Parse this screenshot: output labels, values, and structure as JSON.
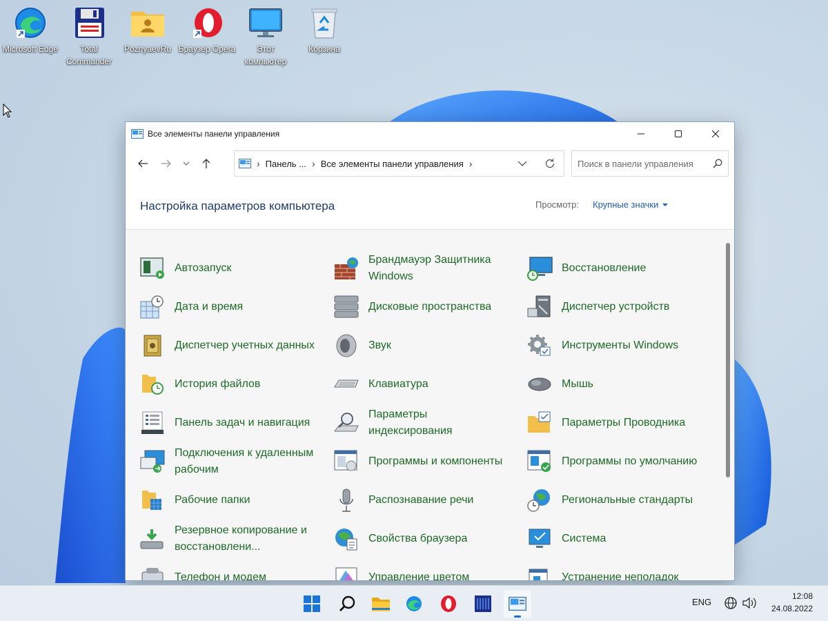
{
  "desktop": {
    "icons": [
      {
        "label": "Microsoft Edge",
        "icon": "edge-icon"
      },
      {
        "label": "Total Commander",
        "icon": "floppy-icon"
      },
      {
        "label": "PoznyaevRu",
        "icon": "user-folder-icon"
      },
      {
        "label": "Браузер Opera",
        "icon": "opera-icon"
      },
      {
        "label": "Этот компьютер",
        "icon": "monitor-icon"
      },
      {
        "label": "Корзина",
        "icon": "recycle-bin-icon"
      }
    ]
  },
  "window": {
    "title": "Все элементы панели управления",
    "breadcrumbs": [
      "Панель ...",
      "Все элементы панели управления"
    ],
    "search_placeholder": "Поиск в панели управления",
    "header_title": "Настройка параметров компьютера",
    "view_label": "Просмотр:",
    "view_value": "Крупные значки",
    "items": [
      {
        "label": "Автозапуск",
        "icon": "autoplay-icon"
      },
      {
        "label": "Брандмауэр Защитника Windows",
        "icon": "firewall-icon"
      },
      {
        "label": "Восстановление",
        "icon": "recovery-icon"
      },
      {
        "label": "Дата и время",
        "icon": "date-time-icon"
      },
      {
        "label": "Дисковые пространства",
        "icon": "storage-spaces-icon"
      },
      {
        "label": "Диспетчер устройств",
        "icon": "device-manager-icon"
      },
      {
        "label": "Диспетчер учетных данных",
        "icon": "credential-manager-icon"
      },
      {
        "label": "Звук",
        "icon": "sound-icon"
      },
      {
        "label": "Инструменты Windows",
        "icon": "windows-tools-icon"
      },
      {
        "label": "История файлов",
        "icon": "file-history-icon"
      },
      {
        "label": "Клавиатура",
        "icon": "keyboard-icon"
      },
      {
        "label": "Мышь",
        "icon": "mouse-icon"
      },
      {
        "label": "Панель задач и навигация",
        "icon": "taskbar-icon"
      },
      {
        "label": "Параметры индексирования",
        "icon": "indexing-icon"
      },
      {
        "label": "Параметры Проводника",
        "icon": "explorer-options-icon"
      },
      {
        "label": "Подключения к удаленным рабочим",
        "icon": "remote-desktop-icon"
      },
      {
        "label": "Программы и компоненты",
        "icon": "programs-icon"
      },
      {
        "label": "Программы по умолчанию",
        "icon": "default-programs-icon"
      },
      {
        "label": "Рабочие папки",
        "icon": "work-folders-icon"
      },
      {
        "label": "Распознавание речи",
        "icon": "speech-icon"
      },
      {
        "label": "Региональные стандарты",
        "icon": "region-icon"
      },
      {
        "label": "Резервное копирование и восстановлени...",
        "icon": "backup-icon"
      },
      {
        "label": "Свойства браузера",
        "icon": "internet-options-icon"
      },
      {
        "label": "Система",
        "icon": "system-icon"
      },
      {
        "label": "Телефон и модем",
        "icon": "phone-modem-icon"
      },
      {
        "label": "Управление цветом",
        "icon": "color-management-icon"
      },
      {
        "label": "Устранение неполадок",
        "icon": "troubleshooting-icon"
      }
    ]
  },
  "taskbar": {
    "apps": [
      "start-icon",
      "search-icon",
      "file-explorer-icon",
      "edge-icon",
      "opera-icon",
      "total-commander-icon",
      "control-panel-icon"
    ],
    "language": "ENG",
    "time": "12:08",
    "date": "24.08.2022"
  }
}
